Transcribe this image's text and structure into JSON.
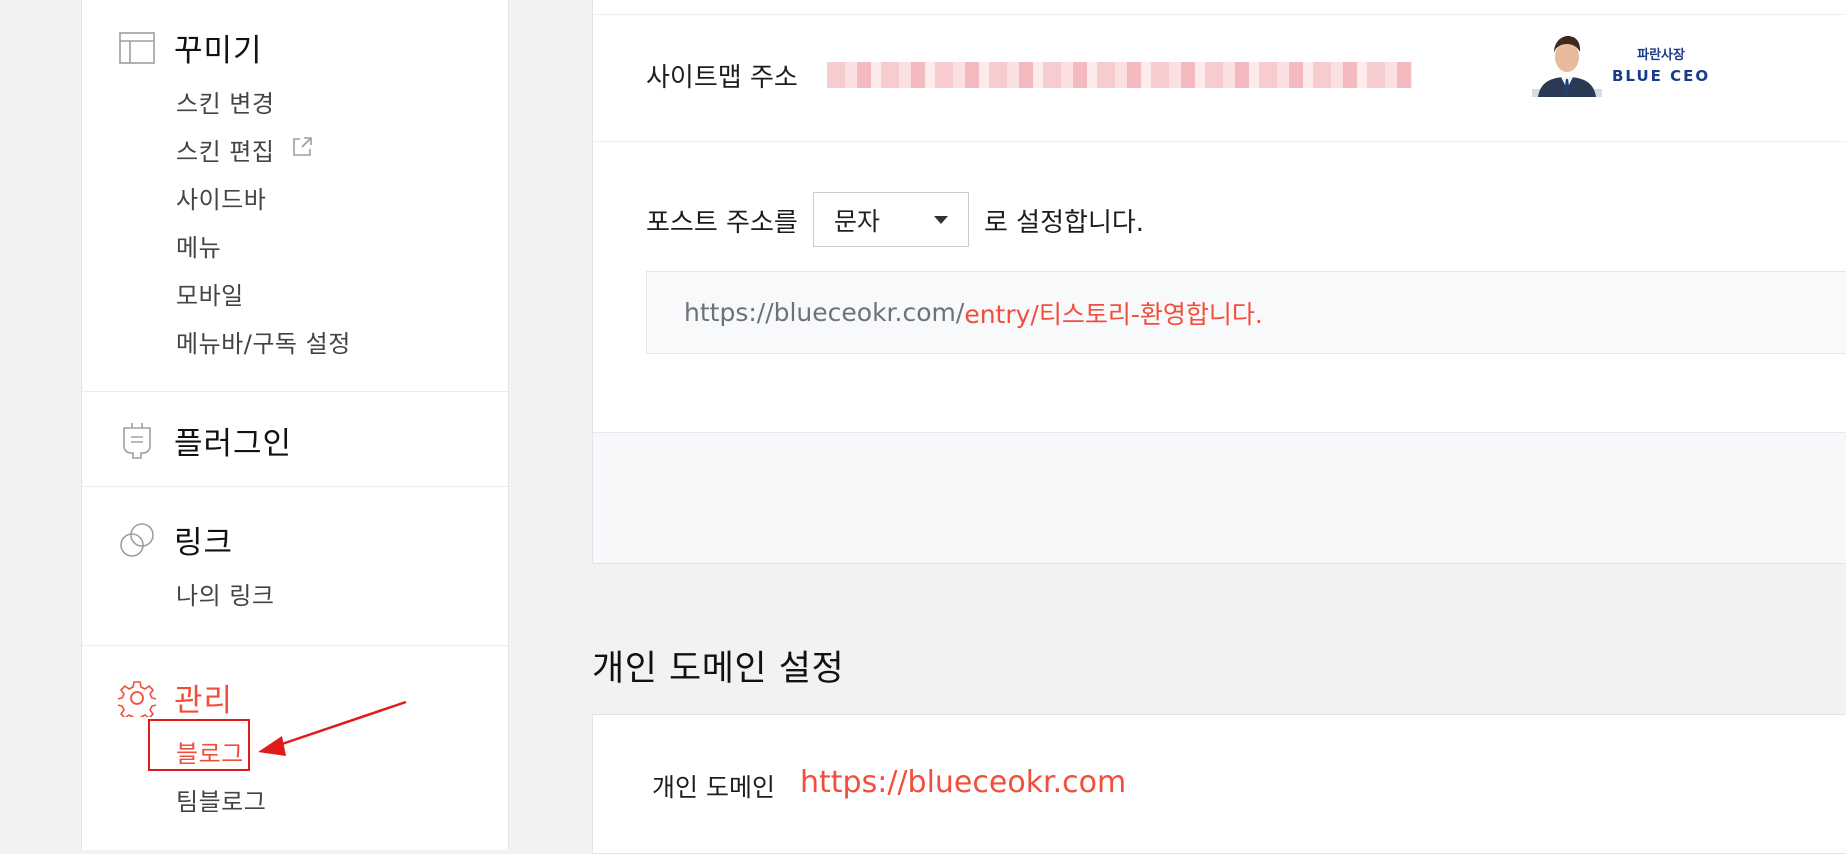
{
  "sidebar": {
    "decorate": {
      "title": "꾸미기",
      "icon": "layout-icon",
      "items": [
        {
          "label": "스킨 변경"
        },
        {
          "label": "스킨 편집",
          "icon": "external-link-icon"
        },
        {
          "label": "사이드바"
        },
        {
          "label": "메뉴"
        },
        {
          "label": "모바일"
        },
        {
          "label": "메뉴바/구독 설정"
        }
      ]
    },
    "plugin": {
      "title": "플러그인",
      "icon": "plug-icon"
    },
    "link": {
      "title": "링크",
      "icon": "link-icon",
      "items": [
        {
          "label": "나의 링크"
        }
      ]
    },
    "manage": {
      "title": "관리",
      "icon": "gear-icon",
      "items": [
        {
          "label": "블로그",
          "active": true
        },
        {
          "label": "팀블로그"
        }
      ]
    }
  },
  "main": {
    "sitemap": {
      "label": "사이트맵 주소"
    },
    "logo": {
      "korean": "파란사장",
      "english": "BLUE CEO"
    },
    "post_url": {
      "prefix": "포스트 주소를",
      "selected": "문자",
      "suffix": "로 설정합니다.",
      "example_base": "https://blueceokr.com/",
      "example_path": "entry/티스토리-환영합니다."
    },
    "domain_section": {
      "heading": "개인 도메인 설정",
      "label": "개인 도메인",
      "value": "https://blueceokr.com"
    }
  },
  "colors": {
    "accent": "#f24e3c",
    "annotation": "#e01b1b"
  }
}
